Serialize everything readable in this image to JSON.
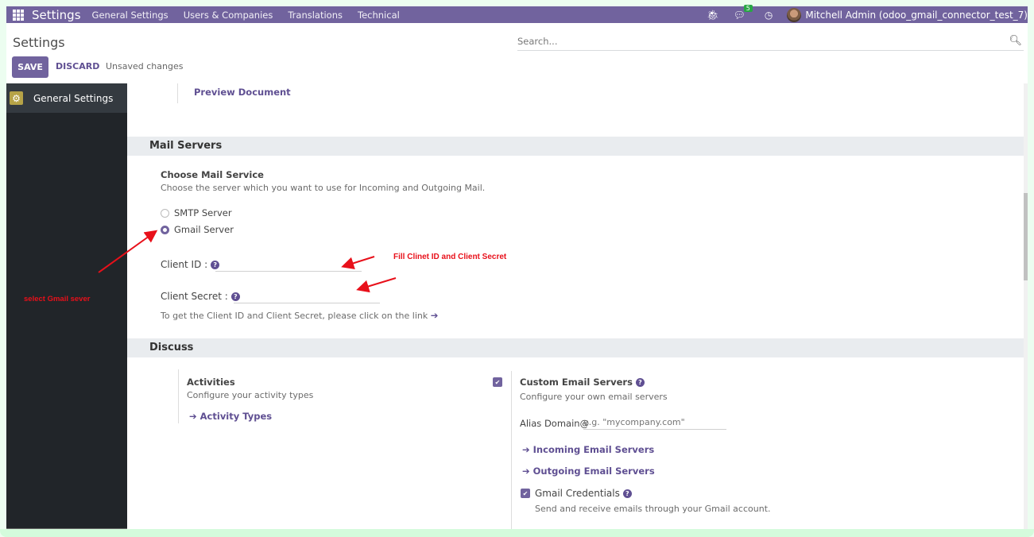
{
  "navbar": {
    "app_title": "Settings",
    "menu": [
      "General Settings",
      "Users & Companies",
      "Translations",
      "Technical"
    ],
    "message_count": "5",
    "user": "Mitchell Admin (odoo_gmail_connector_test_7)"
  },
  "control_panel": {
    "title": "Settings",
    "search_placeholder": "Search...",
    "save_label": "SAVE",
    "discard_label": "DISCARD",
    "status": "Unsaved changes"
  },
  "sidebar": {
    "items": [
      {
        "label": "General Settings",
        "icon": "gear-icon",
        "active": true
      }
    ]
  },
  "content": {
    "preview_link": "Preview Document",
    "mail_servers": {
      "heading": "Mail Servers",
      "choose_title": "Choose Mail Service",
      "choose_desc": "Choose the server which you want to use for Incoming and Outgoing Mail.",
      "options": [
        {
          "label": "SMTP Server",
          "checked": false
        },
        {
          "label": "Gmail Server",
          "checked": true
        }
      ],
      "client_id_label": "Client ID :",
      "client_id_value": "",
      "client_secret_label": "Client Secret :",
      "client_secret_value": "",
      "link_hint": "To get the Client ID and Client Secret, please click on the link"
    },
    "discuss": {
      "heading": "Discuss",
      "activities_title": "Activities",
      "activities_desc": "Configure your activity types",
      "activity_types_link": "Activity Types",
      "custom_servers_title": "Custom Email Servers",
      "custom_servers_checked": true,
      "custom_servers_desc": "Configure your own email servers",
      "alias_label": "Alias Domain@",
      "alias_placeholder": "e.g. \"mycompany.com\"",
      "incoming_link": "Incoming Email Servers",
      "outgoing_link": "Outgoing Email Servers",
      "gmail_cred_title": "Gmail Credentials",
      "gmail_cred_checked": true,
      "gmail_cred_desc": "Send and receive emails through your Gmail account."
    }
  },
  "annotations": {
    "select_gmail": "select Gmail sever",
    "fill_client": "Fill Clinet ID and Client Secret"
  }
}
